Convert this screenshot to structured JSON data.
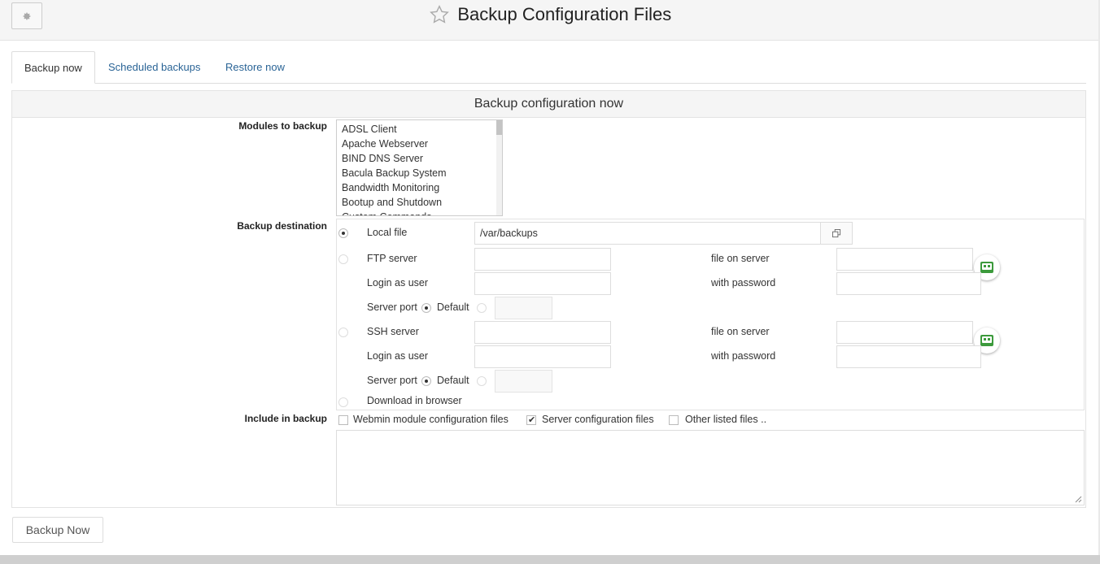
{
  "header": {
    "title": "Backup Configuration Files"
  },
  "tabs": [
    {
      "label": "Backup now",
      "active": true
    },
    {
      "label": "Scheduled backups",
      "active": false
    },
    {
      "label": "Restore now",
      "active": false
    }
  ],
  "panel": {
    "title": "Backup configuration now",
    "modules_label": "Modules to backup",
    "modules": [
      "ADSL Client",
      "Apache Webserver",
      "BIND DNS Server",
      "Bacula Backup System",
      "Bandwidth Monitoring",
      "Bootup and Shutdown",
      "Custom Commands"
    ],
    "destination_label": "Backup destination",
    "local": {
      "label": "Local file",
      "value": "/var/backups",
      "selected": true
    },
    "ftp": {
      "label": "FTP server",
      "file_label": "file on server",
      "login_label": "Login as user",
      "password_label": "with password",
      "port_label": "Server port",
      "default_label": "Default"
    },
    "ssh": {
      "label": "SSH server",
      "file_label": "file on server",
      "login_label": "Login as user",
      "password_label": "with password",
      "port_label": "Server port",
      "default_label": "Default"
    },
    "download_label": "Download in browser",
    "include_label": "Include in backup",
    "include": {
      "webmin": {
        "label": "Webmin module configuration files",
        "checked": false
      },
      "server": {
        "label": "Server configuration files",
        "checked": true
      },
      "other": {
        "label": "Other listed files ..",
        "checked": false
      }
    }
  },
  "actions": {
    "backup_now": "Backup Now"
  },
  "colors": {
    "link": "#2a6496",
    "key_icon": "#3c9a3c"
  }
}
